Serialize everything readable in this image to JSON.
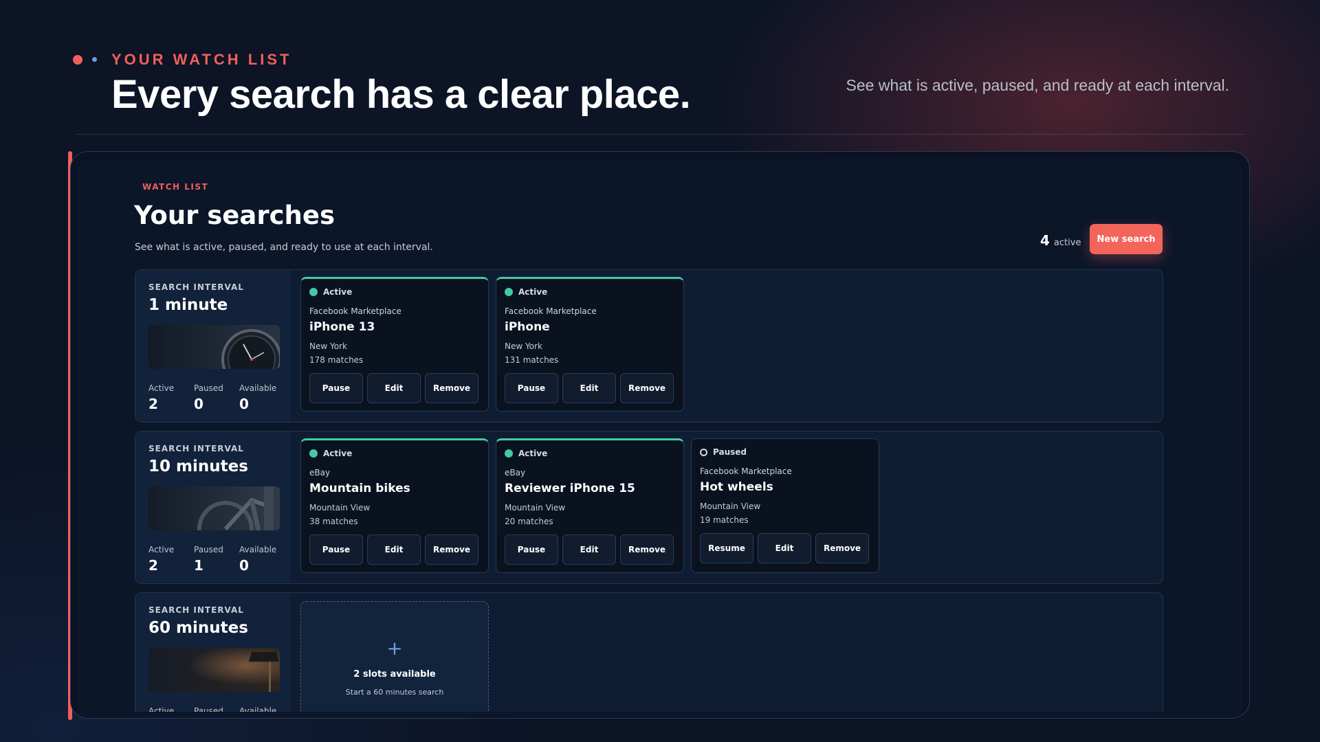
{
  "hero": {
    "eyebrow": "YOUR WATCH LIST",
    "title": "Every search has a clear place.",
    "subtitle": "See what is active, paused, and ready at each interval."
  },
  "panel": {
    "eyebrow": "WATCH LIST",
    "title": "Your searches",
    "subtitle": "See what is active, paused, and ready to use at each interval.",
    "active_count": "4",
    "active_label": "active",
    "new_button": "New search"
  },
  "stat_labels": {
    "active": "Active",
    "paused": "Paused",
    "available": "Available"
  },
  "groups": [
    {
      "eyebrow": "SEARCH INTERVAL",
      "title": "1 minute",
      "stats": {
        "active": "2",
        "paused": "0",
        "available": "0"
      },
      "cards": [
        {
          "status": "Active",
          "source": "Facebook Marketplace",
          "title": "iPhone 13",
          "location": "New York",
          "matches": "178 matches",
          "actions": [
            "Pause",
            "Edit",
            "Remove"
          ]
        },
        {
          "status": "Active",
          "source": "Facebook Marketplace",
          "title": "iPhone",
          "location": "New York",
          "matches": "131 matches",
          "actions": [
            "Pause",
            "Edit",
            "Remove"
          ]
        }
      ]
    },
    {
      "eyebrow": "SEARCH INTERVAL",
      "title": "10 minutes",
      "stats": {
        "active": "2",
        "paused": "1",
        "available": "0"
      },
      "cards": [
        {
          "status": "Active",
          "source": "eBay",
          "title": "Mountain bikes",
          "location": "Mountain View",
          "matches": "38 matches",
          "actions": [
            "Pause",
            "Edit",
            "Remove"
          ]
        },
        {
          "status": "Active",
          "source": "eBay",
          "title": "Reviewer iPhone 15",
          "location": "Mountain View",
          "matches": "20 matches",
          "actions": [
            "Pause",
            "Edit",
            "Remove"
          ]
        },
        {
          "status": "Paused",
          "source": "Facebook Marketplace",
          "title": "Hot wheels",
          "location": "Mountain View",
          "matches": "19 matches",
          "actions": [
            "Resume",
            "Edit",
            "Remove"
          ]
        }
      ]
    },
    {
      "eyebrow": "SEARCH INTERVAL",
      "title": "60 minutes",
      "stats": {
        "active": "",
        "paused": "",
        "available": ""
      },
      "slot": {
        "title": "2 slots available",
        "subtitle": "Start a 60 minutes search"
      }
    }
  ],
  "colors": {
    "accent": "#f0605a",
    "active": "#46c9a3",
    "background": "#0c1426"
  }
}
